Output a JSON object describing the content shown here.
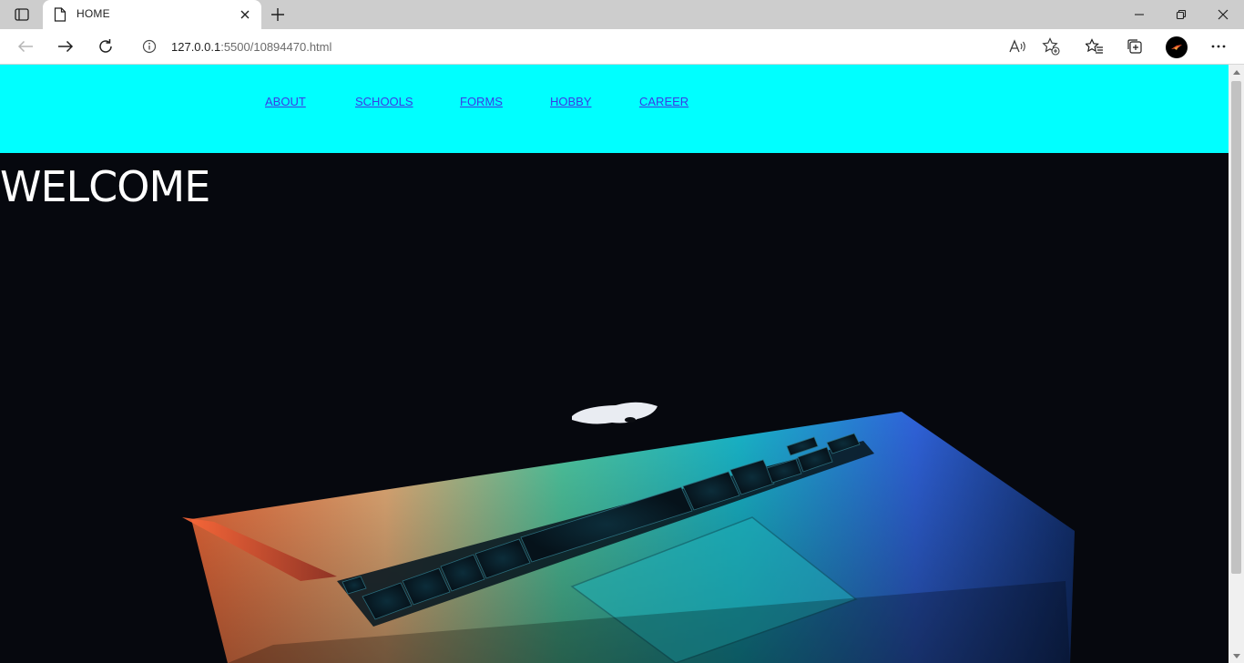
{
  "browser": {
    "tab": {
      "title": "HOME"
    },
    "address": {
      "host": "127.0.0.1",
      "path": ":5500/10894470.html"
    },
    "profile_color": "#000000"
  },
  "page": {
    "nav_links": [
      "ABOUT",
      "SCHOOLS",
      "FORMS",
      "HOBBY",
      "CAREER"
    ],
    "heading": "WELCOME",
    "navbar_color": "#00ffff",
    "link_color": "#3a3ae6",
    "hero_background": "#06080e",
    "hero_image": "laptop-keyboard-glowing-image"
  }
}
